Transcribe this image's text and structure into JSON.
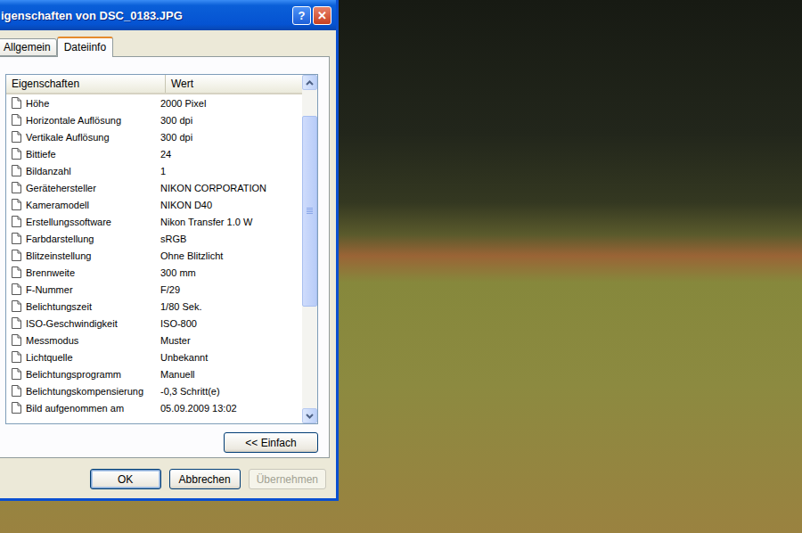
{
  "window": {
    "title": "igenschaften von DSC_0183.JPG",
    "controls": [
      "?",
      "✕"
    ]
  },
  "tabs": [
    {
      "label": "Allgemein",
      "selected": false
    },
    {
      "label": "Dateiinfo",
      "selected": true
    }
  ],
  "table": {
    "columns": [
      "Eigenschaften",
      "Wert"
    ],
    "rows": [
      {
        "name": "Höhe",
        "value": "2000 Pixel"
      },
      {
        "name": "Horizontale Auflösung",
        "value": "300 dpi"
      },
      {
        "name": "Vertikale Auflösung",
        "value": "300 dpi"
      },
      {
        "name": "Bittiefe",
        "value": "24"
      },
      {
        "name": "Bildanzahl",
        "value": "1"
      },
      {
        "name": "Gerätehersteller",
        "value": "NIKON CORPORATION"
      },
      {
        "name": "Kameramodell",
        "value": "NIKON D40"
      },
      {
        "name": "Erstellungssoftware",
        "value": "Nikon Transfer 1.0 W"
      },
      {
        "name": "Farbdarstellung",
        "value": "sRGB"
      },
      {
        "name": "Blitzeinstellung",
        "value": "Ohne Blitzlicht"
      },
      {
        "name": "Brennweite",
        "value": "300 mm"
      },
      {
        "name": "F-Nummer",
        "value": "F/29"
      },
      {
        "name": "Belichtungszeit",
        "value": "1/80 Sek."
      },
      {
        "name": "ISO-Geschwindigkeit",
        "value": "ISO-800"
      },
      {
        "name": "Messmodus",
        "value": "Muster"
      },
      {
        "name": "Lichtquelle",
        "value": "Unbekannt"
      },
      {
        "name": "Belichtungsprogramm",
        "value": "Manuell"
      },
      {
        "name": "Belichtungskompensierung",
        "value": "-0,3 Schritt(e)"
      },
      {
        "name": "Bild aufgenommen am",
        "value": "05.09.2009 13:02"
      }
    ],
    "scrollbar": {
      "position": 0.08,
      "size": 0.6
    }
  },
  "toggle_button": "<< Einfach",
  "buttons": [
    {
      "label": "OK",
      "disabled": false,
      "default": true
    },
    {
      "label": "Abbrechen",
      "disabled": false,
      "default": false
    },
    {
      "label": "Übernehmen",
      "disabled": true,
      "default": false
    }
  ]
}
